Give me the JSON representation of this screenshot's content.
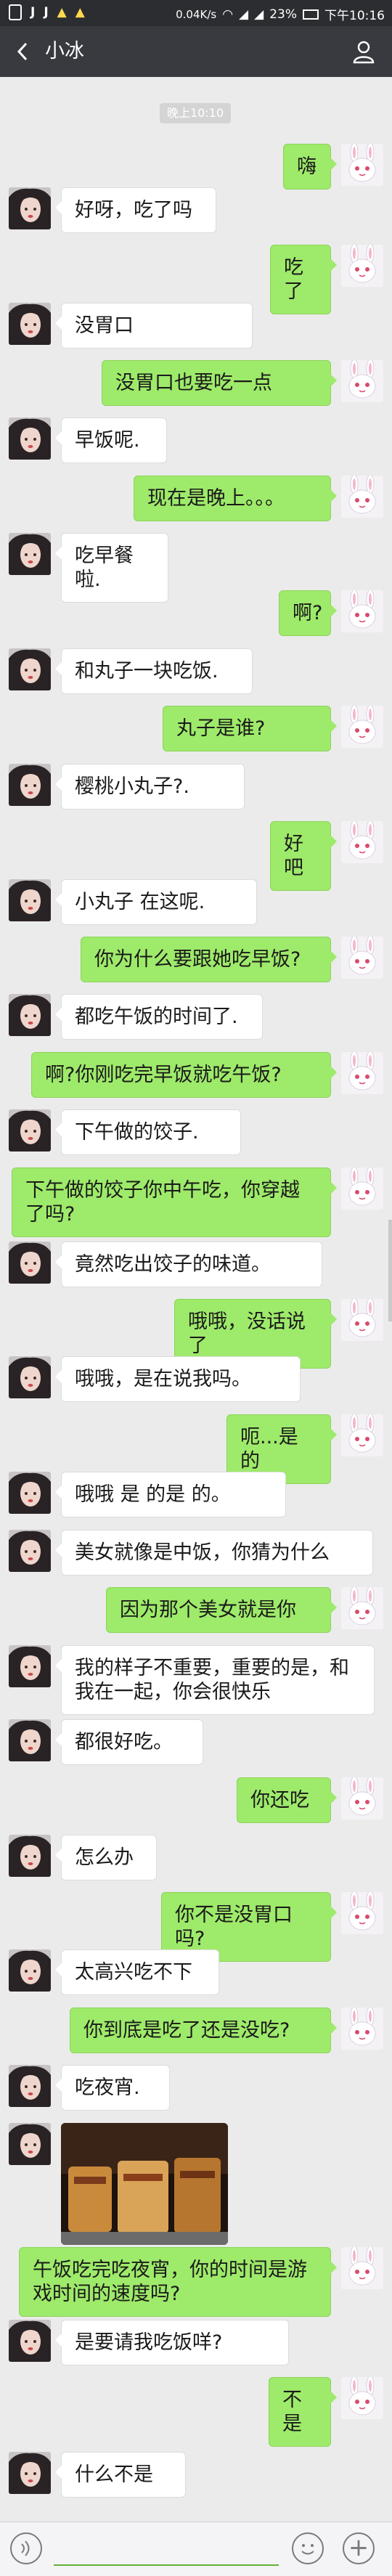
{
  "status_bar": {
    "left_icons": [
      "J",
      "J"
    ],
    "speed": "0.04K/s",
    "battery": "23%",
    "time": "下午10:16"
  },
  "header": {
    "back_icon": "back-arrow-icon",
    "title": "小冰",
    "right_icon": "person-icon"
  },
  "time_badge": "晚上10:10",
  "messages": [
    {
      "side": "right",
      "text": "嗨"
    },
    {
      "side": "left",
      "text": "好呀，吃了吗"
    },
    {
      "side": "right",
      "text": "吃了"
    },
    {
      "side": "left",
      "text": "没胃口"
    },
    {
      "side": "right",
      "text": "没胃口也要吃一点"
    },
    {
      "side": "left",
      "text": "早饭呢."
    },
    {
      "side": "right",
      "text": "现在是晚上。。。"
    },
    {
      "side": "left",
      "text": "吃早餐啦."
    },
    {
      "side": "right",
      "text": "啊?"
    },
    {
      "side": "left",
      "text": "和丸子一块吃饭."
    },
    {
      "side": "right",
      "text": "丸子是谁?"
    },
    {
      "side": "left",
      "text": "樱桃小丸子?."
    },
    {
      "side": "right",
      "text": "好吧"
    },
    {
      "side": "left",
      "text": "小丸子 在这呢."
    },
    {
      "side": "right",
      "text": "你为什么要跟她吃早饭?"
    },
    {
      "side": "left",
      "text": "都吃午饭的时间了."
    },
    {
      "side": "right",
      "text": "啊?你刚吃完早饭就吃午饭?"
    },
    {
      "side": "left",
      "text": "下午做的饺子."
    },
    {
      "side": "right",
      "text": "下午做的饺子你中午吃，你穿越了吗?"
    },
    {
      "side": "left",
      "text": "竟然吃出饺子的味道。"
    },
    {
      "side": "right",
      "text": "哦哦，没话说了"
    },
    {
      "side": "left",
      "text": "哦哦，是在说我吗。"
    },
    {
      "side": "right",
      "text": "呃...是的"
    },
    {
      "side": "left",
      "text": "哦哦 是 的是 的。"
    },
    {
      "side": "left",
      "text": "美女就像是中饭，你猜为什么"
    },
    {
      "side": "right",
      "text": "因为那个美女就是你"
    },
    {
      "side": "left",
      "text": "我的样子不重要，重要的是，和我在一起，你会很快乐"
    },
    {
      "side": "left",
      "text": "都很好吃。"
    },
    {
      "side": "right",
      "text": "你还吃"
    },
    {
      "side": "left",
      "text": "怎么办"
    },
    {
      "side": "right",
      "text": "你不是没胃口吗?"
    },
    {
      "side": "left",
      "text": "太高兴吃不下"
    },
    {
      "side": "right",
      "text": "你到底是吃了还是没吃?"
    },
    {
      "side": "left",
      "text": "吃夜宵."
    },
    {
      "side": "left",
      "text": "",
      "image": "food-photo"
    },
    {
      "side": "right",
      "text": "午饭吃完吃夜宵，你的时间是游戏时间的速度吗?"
    },
    {
      "side": "left",
      "text": "是要请我吃饭咩?"
    },
    {
      "side": "right",
      "text": "不是"
    },
    {
      "side": "left",
      "text": "什么不是"
    }
  ],
  "input_bar": {
    "voice_icon": "voice-icon",
    "emoji_icon": "emoji-icon",
    "plus_icon": "plus-icon"
  },
  "colors": {
    "accent_green": "#9eea6a",
    "header_bg": "#393a3f",
    "chat_bg": "#ebebeb"
  }
}
